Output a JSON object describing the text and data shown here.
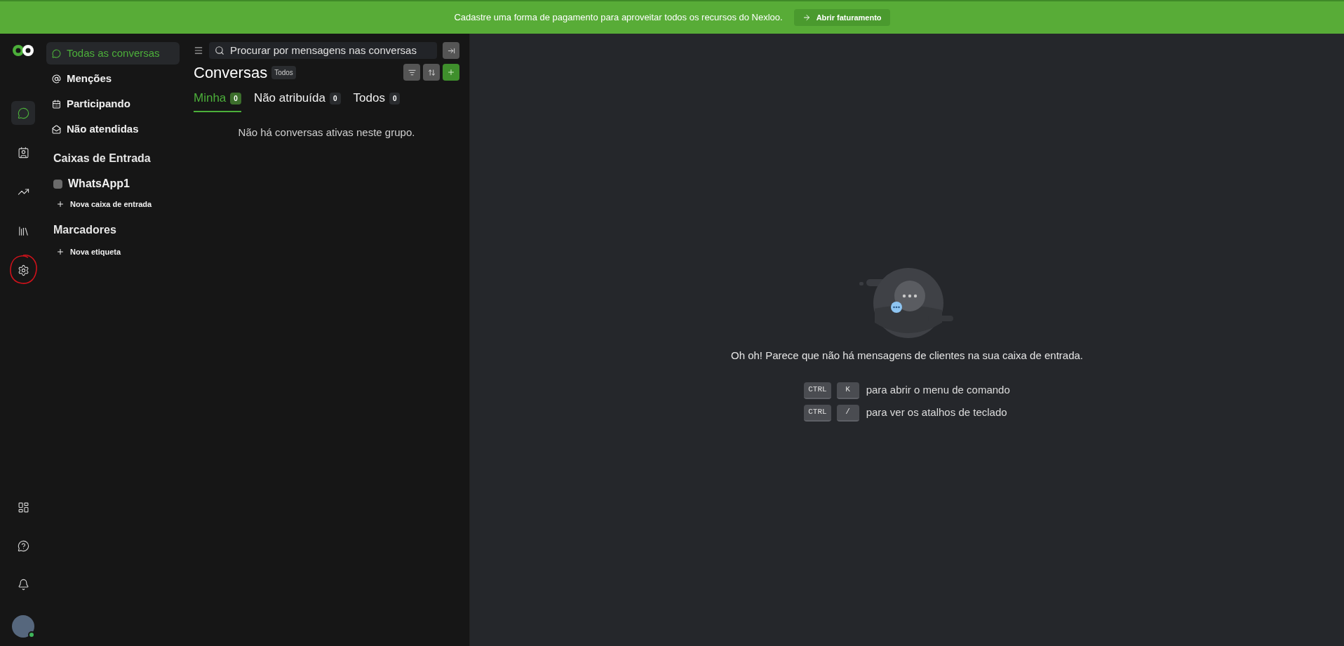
{
  "banner": {
    "message": "Cadastre uma forma de pagamento para aproveitar todos os recursos do Nexloo.",
    "button": "Abrir faturamento"
  },
  "rail": [
    {
      "kind": "chat",
      "selected": true,
      "circled": false
    },
    {
      "kind": "contacts",
      "selected": false,
      "circled": false
    },
    {
      "kind": "reports",
      "selected": false,
      "circled": false
    },
    {
      "kind": "library",
      "selected": false,
      "circled": false
    },
    {
      "kind": "settings",
      "selected": false,
      "circled": true
    }
  ],
  "rail_bottom": [
    {
      "kind": "dashboard"
    },
    {
      "kind": "help"
    },
    {
      "kind": "bell"
    }
  ],
  "avatar": {
    "online": true
  },
  "nav": {
    "items": [
      {
        "kind": "chat",
        "label": "Todas as conversas",
        "selected": true
      },
      {
        "kind": "mention",
        "label": "Menções",
        "selected": false
      },
      {
        "kind": "participating",
        "label": "Participando",
        "selected": false
      },
      {
        "kind": "unattended",
        "label": "Não atendidas",
        "selected": false
      }
    ],
    "inboxes_heading": "Caixas de Entrada",
    "inboxes": [
      {
        "label": "WhatsApp1"
      }
    ],
    "new_inbox": "Nova caixa de entrada",
    "labels_heading": "Marcadores",
    "new_label": "Nova etiqueta"
  },
  "conversations": {
    "search_placeholder": "Procurar por mensagens nas conversas",
    "title": "Conversas",
    "status_filter": "Todos",
    "tabs": [
      {
        "label": "Minha",
        "count": "0",
        "selected": true
      },
      {
        "label": "Não atribuída",
        "count": "0",
        "selected": false
      },
      {
        "label": "Todos",
        "count": "0",
        "selected": false
      }
    ],
    "empty_text": "Não há conversas ativas neste grupo."
  },
  "main": {
    "message": "Oh oh! Parece que não há mensagens de clientes na sua caixa de entrada.",
    "shortcuts": [
      {
        "keys": [
          "CTRL",
          "K"
        ],
        "description": "para abrir o menu de comando"
      },
      {
        "keys": [
          "CTRL",
          "/"
        ],
        "description": "para ver os atalhos de teclado"
      }
    ]
  }
}
